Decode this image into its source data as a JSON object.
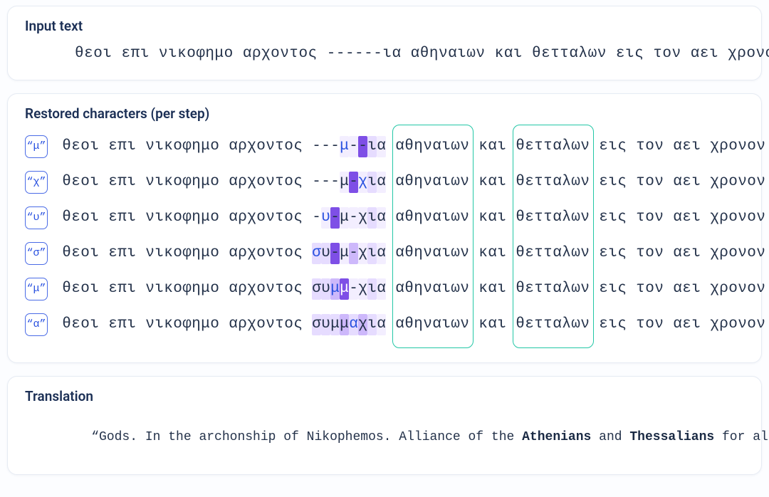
{
  "input": {
    "title": "Input text",
    "text": "θεοι επι νικοφημο αρχοντος ------ια αθηναιων και θετταλων εις τον αει χρονον"
  },
  "restored": {
    "title": "Restored characters (per step)",
    "base_left": "θεοι επι νικοφημο αρχοντος ",
    "base_right": " αθηναιων και θετταλων εις τον αει χρονον",
    "gap_length": 8,
    "steps": [
      {
        "tag": "“μ”",
        "chars": [
          "-",
          "-",
          "-",
          "μ",
          "-",
          "-",
          "ι",
          "α"
        ],
        "new_idx": 3,
        "heat": [
          0,
          0,
          0,
          1,
          1,
          5,
          2,
          1
        ]
      },
      {
        "tag": "“χ”",
        "chars": [
          "-",
          "-",
          "-",
          "μ",
          "-",
          "χ",
          "ι",
          "α"
        ],
        "new_idx": 5,
        "heat": [
          0,
          0,
          0,
          1,
          5,
          1,
          2,
          1
        ]
      },
      {
        "tag": "“υ”",
        "chars": [
          "-",
          "υ",
          "-",
          "μ",
          "-",
          "χ",
          "ι",
          "α"
        ],
        "new_idx": 1,
        "heat": [
          0,
          1,
          5,
          1,
          1,
          1,
          2,
          1
        ]
      },
      {
        "tag": "“σ”",
        "chars": [
          "σ",
          "υ",
          "-",
          "μ",
          "-",
          "χ",
          "ι",
          "α"
        ],
        "new_idx": 0,
        "heat": [
          2,
          2,
          5,
          1,
          3,
          1,
          2,
          1
        ]
      },
      {
        "tag": "“μ”",
        "chars": [
          "σ",
          "υ",
          "μ",
          "μ",
          "-",
          "χ",
          "ι",
          "α"
        ],
        "new_idx": 2,
        "heat": [
          2,
          2,
          3,
          5,
          1,
          1,
          2,
          1
        ]
      },
      {
        "tag": "“α”",
        "chars": [
          "σ",
          "υ",
          "μ",
          "μ",
          "α",
          "χ",
          "ι",
          "α"
        ],
        "new_idx": 4,
        "heat": [
          2,
          2,
          2,
          3,
          2,
          3,
          2,
          1
        ]
      }
    ],
    "focus_words": [
      "αθηναιων",
      "θετταλων"
    ]
  },
  "translation": {
    "title": "Translation",
    "prefix": "“Gods. In the archonship of Nikophemos. Alliance of the ",
    "bold1": "Athenians",
    "mid": " and ",
    "bold2": "Thessalians",
    "suffix": " for all time”"
  }
}
